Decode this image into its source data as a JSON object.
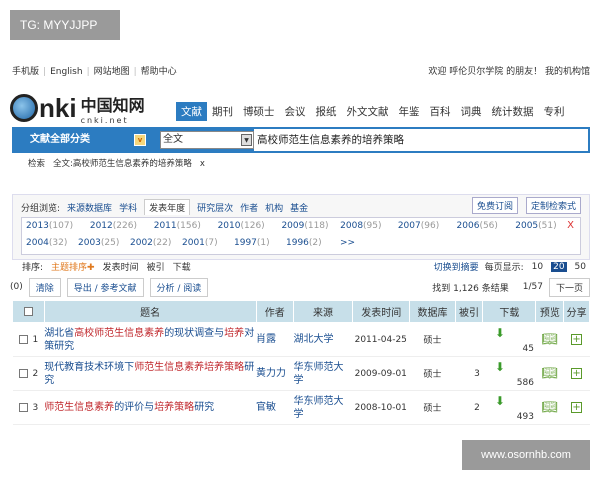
{
  "watermarks": {
    "top": "TG: MYYJJPP",
    "bottom": "www.osornhb.com"
  },
  "topbar": {
    "links": [
      "手机版",
      "English",
      "网站地图",
      "帮助中心"
    ],
    "welcome": "欢迎  呼伦贝尔学院 的朋友！ 我的机构馆"
  },
  "logo": {
    "text": "CNKI",
    "cn": "中国知网",
    "url": "cnki.net"
  },
  "nav": [
    "文献",
    "期刊",
    "博硕士",
    "会议",
    "报纸",
    "外文文献",
    "年鉴",
    "百科",
    "词典",
    "统计数据",
    "专利"
  ],
  "search": {
    "category": "文献全部分类",
    "field": "全文",
    "query": "高校师范生信息素养的培养策略"
  },
  "crumb": {
    "label": "检索",
    "value": "全文:高校师范生信息素养的培养策略",
    "close": "x"
  },
  "group": {
    "label": "分组浏览:",
    "tabs": [
      "来源数据库",
      "学科",
      "发表年度",
      "研究层次",
      "作者",
      "机构",
      "基金"
    ],
    "selected": "发表年度",
    "buttons": [
      "免费订阅",
      "定制检索式"
    ],
    "years": [
      [
        "2013",
        "(107)"
      ],
      [
        "2012",
        "(226)"
      ],
      [
        "2011",
        "(156)"
      ],
      [
        "2010",
        "(126)"
      ],
      [
        "2009",
        "(118)"
      ],
      [
        "2008",
        "(95)"
      ],
      [
        "2007",
        "(96)"
      ],
      [
        "2006",
        "(56)"
      ],
      [
        "2005",
        "(51)"
      ],
      [
        "2004",
        "(32)"
      ],
      [
        "2003",
        "(25)"
      ],
      [
        "2002",
        "(22)"
      ],
      [
        "2001",
        "(7)"
      ],
      [
        "1997",
        "(1)"
      ],
      [
        "1996",
        "(2)"
      ]
    ],
    "more": ">>",
    "close": "X"
  },
  "sort": {
    "label": "排序:",
    "items": [
      "主题排序✚",
      "发表时间",
      "被引",
      "下载"
    ],
    "switch": "切换到摘要",
    "perpage": "每页显示:",
    "sizes": [
      "10",
      "20",
      "50"
    ],
    "current": "20"
  },
  "toolbar": {
    "count": "(0)",
    "clear": "清除",
    "export": "导出 / 参考文献",
    "analyze": "分析 / 阅读",
    "found": "找到 1,126 条结果",
    "page": "1/57",
    "next": "下一页"
  },
  "table": {
    "headers": [
      "题名",
      "作者",
      "来源",
      "发表时间",
      "数据库",
      "被引",
      "下载",
      "预览",
      "分享"
    ],
    "rows": [
      {
        "n": "1",
        "title": [
          [
            "湖北省",
            0
          ],
          [
            "高校师范生信息素养",
            1
          ],
          [
            "的现状调查与",
            0
          ],
          [
            "培养",
            1
          ],
          [
            "对策研究",
            0
          ]
        ],
        "author": "肖露",
        "source": "湖北大学",
        "date": "2011-04-25",
        "db": "硕士",
        "cited": "",
        "downloads": "45"
      },
      {
        "n": "2",
        "title": [
          [
            "现代教育技术环境下",
            0
          ],
          [
            "师范生信息素养培养策略",
            1
          ],
          [
            "研究",
            0
          ]
        ],
        "author": "黄力力",
        "source": "华东师范大学",
        "date": "2009-09-01",
        "db": "硕士",
        "cited": "3",
        "downloads": "586"
      },
      {
        "n": "3",
        "title": [
          [
            "师范生信息素养",
            1
          ],
          [
            "的评价与",
            0
          ],
          [
            "培养策略",
            1
          ],
          [
            "研究",
            0
          ]
        ],
        "author": "官敏",
        "source": "华东师范大学",
        "date": "2008-10-01",
        "db": "硕士",
        "cited": "2",
        "downloads": "493"
      }
    ]
  }
}
